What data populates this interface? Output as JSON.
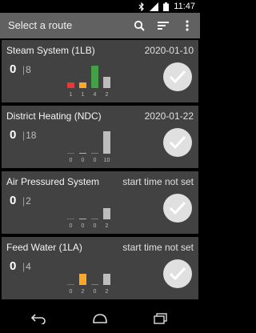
{
  "status": {
    "time": "11:47"
  },
  "app": {
    "title": "Select a route"
  },
  "colors": {
    "red": "#e53935",
    "orange": "#ffa726",
    "green": "#43a047",
    "gray": "#bdbdbd"
  },
  "routes": [
    {
      "name": "Steam System (1LB)",
      "meta": "2020-01-10",
      "done": "0",
      "total": "8",
      "bars": [
        {
          "label": "1",
          "value": 1,
          "color": "red"
        },
        {
          "label": "1",
          "value": 1,
          "color": "orange"
        },
        {
          "label": "4",
          "value": 4,
          "color": "green"
        },
        {
          "label": "2",
          "value": 2,
          "color": "gray"
        }
      ]
    },
    {
      "name": "District Heating (NDC)",
      "meta": "2020-01-22",
      "done": "0",
      "total": "18",
      "bars": [
        {
          "label": "0",
          "value": 0,
          "color": "red"
        },
        {
          "label": "0",
          "value": 0,
          "color": "orange"
        },
        {
          "label": "0",
          "value": 0,
          "color": "green"
        },
        {
          "label": "10",
          "value": 10,
          "color": "gray"
        }
      ]
    },
    {
      "name": "Air Pressured System",
      "meta": "start time not set",
      "done": "0",
      "total": "2",
      "bars": [
        {
          "label": "0",
          "value": 0,
          "color": "red"
        },
        {
          "label": "0",
          "value": 0,
          "color": "orange"
        },
        {
          "label": "0",
          "value": 0,
          "color": "green"
        },
        {
          "label": "2",
          "value": 2,
          "color": "gray"
        }
      ]
    },
    {
      "name": "Feed Water (1LA)",
      "meta": "start time not set",
      "done": "0",
      "total": "4",
      "bars": [
        {
          "label": "0",
          "value": 0,
          "color": "red"
        },
        {
          "label": "2",
          "value": 2,
          "color": "orange"
        },
        {
          "label": "0",
          "value": 0,
          "color": "green"
        },
        {
          "label": "2",
          "value": 2,
          "color": "gray"
        }
      ]
    }
  ]
}
